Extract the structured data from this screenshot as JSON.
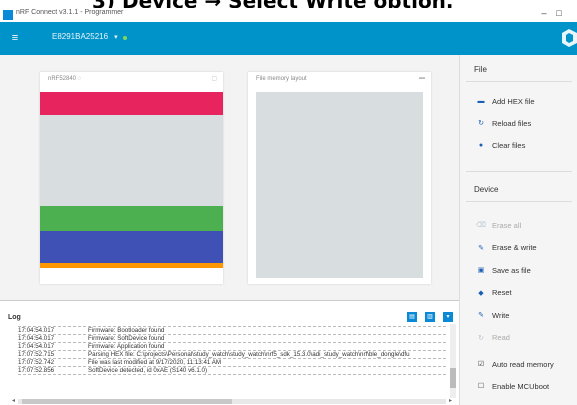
{
  "caption": "3) Device → Select Write option.",
  "window": {
    "title": "nRF Connect v3.1.1 - Programmer",
    "min": "–",
    "max": "□"
  },
  "header": {
    "menu_icon": "hamburger-icon",
    "device": "E8291BA25216",
    "device_chevron": "▾",
    "status": "connected",
    "logo": "nordic-logo",
    "accent": "#0093c9"
  },
  "cards": {
    "device": {
      "title": "nRF52840 ◌",
      "regions": [
        {
          "label": "bootloader",
          "color": "#e8245f"
        },
        {
          "label": "empty",
          "color": "#d8dde0"
        },
        {
          "label": "application",
          "color": "#4caf50"
        },
        {
          "label": "softdevice",
          "color": "#3f51b5"
        },
        {
          "label": "mbr",
          "color": "#ff9800"
        }
      ]
    },
    "file": {
      "title": "File memory layout",
      "fill": "#d8dde0"
    }
  },
  "sidebar": {
    "file_title": "File",
    "file_buttons": [
      {
        "label": "Add HEX file",
        "icon": "folder-icon",
        "glyph": "▬"
      },
      {
        "label": "Reload files",
        "icon": "reload-icon",
        "glyph": "↻"
      },
      {
        "label": "Clear files",
        "icon": "clear-icon",
        "glyph": "●"
      }
    ],
    "device_title": "Device",
    "device_buttons": [
      {
        "label": "Erase all",
        "icon": "eraser-icon",
        "glyph": "⌫",
        "enabled": false
      },
      {
        "label": "Erase & write",
        "icon": "pencil-icon",
        "glyph": "✎",
        "enabled": true
      },
      {
        "label": "Save as file",
        "icon": "save-icon",
        "glyph": "▣",
        "enabled": true
      },
      {
        "label": "Reset",
        "icon": "reset-icon",
        "glyph": "◆",
        "enabled": true
      },
      {
        "label": "Write",
        "icon": "pencil-icon",
        "glyph": "✎",
        "enabled": true
      },
      {
        "label": "Read",
        "icon": "read-icon",
        "glyph": "↻",
        "enabled": false
      }
    ],
    "toggles": [
      {
        "label": "Auto read memory",
        "checked": true,
        "glyph": "☑"
      },
      {
        "label": "Enable MCUboot",
        "checked": false,
        "glyph": "☐"
      }
    ]
  },
  "log": {
    "title": "Log",
    "buttons": [
      "▤",
      "▥",
      "▾"
    ],
    "rows": [
      {
        "time": "17:04:54.017",
        "msg": "Firmware: Bootloader found"
      },
      {
        "time": "17:04:54.017",
        "msg": "Firmware: Bootloader found"
      },
      {
        "time": "17:04:54.017",
        "msg": "Firmware: SoftDevice found"
      },
      {
        "time": "17:04:54.017",
        "msg": "Firmware: Application found"
      },
      {
        "time": "17:07:52.715",
        "msg": "Parsing HEX file: C:\\projects\\Personal\\study_watch\\study_watch\\nrf5_sdk_15.3.0\\adi_study_watch\\nrf\\ble_dongle\\dfu"
      },
      {
        "time": "17:07:52.742",
        "msg": "File was last modified at 9/17/2020, 11:13:41 AM"
      },
      {
        "time": "17:07:52.856",
        "msg": "SoftDevice detected, id 0xAE (S140 v6.1.0)"
      }
    ]
  }
}
